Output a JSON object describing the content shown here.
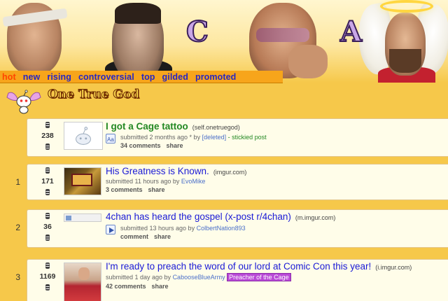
{
  "header": {
    "letters": [
      "C",
      "A"
    ]
  },
  "tabs": [
    "hot",
    "new",
    "rising",
    "controversial",
    "top",
    "gilded",
    "promoted"
  ],
  "subreddit": {
    "title": "One True God"
  },
  "posts": [
    {
      "rank": "",
      "score": "238",
      "title": "I got a Cage tattoo",
      "domain": "(self.onetruegod)",
      "meta_prefix": "submitted 2 months ago * by ",
      "author": "[deleted]",
      "meta_suffix": " - stickied post",
      "comments": "34 comments",
      "share": "share",
      "icon": "self-post-icon"
    },
    {
      "rank": "1",
      "score": "171",
      "title": "His Greatness is Known.",
      "domain": "(imgur.com)",
      "meta_prefix": "submitted 11 hours ago by ",
      "author": "EvoMike",
      "comments": "3 comments",
      "share": "share"
    },
    {
      "rank": "2",
      "score": "36",
      "title": "4chan has heard the gospel (x-post r/4chan)",
      "domain": "(m.imgur.com)",
      "meta_prefix": "submitted 13 hours ago by ",
      "author": "ColbertNation893",
      "comments": "comment",
      "share": "share"
    },
    {
      "rank": "3",
      "score": "1169",
      "title": "I'm ready to preach the word of our lord at Comic Con this year!",
      "domain": "(i.imgur.com)",
      "meta_prefix": "submitted 1 day ago by ",
      "author": "CabooseBlueArmy",
      "flair": "Preacher of the Cage",
      "comments": "42 comments",
      "share": "share"
    }
  ]
}
